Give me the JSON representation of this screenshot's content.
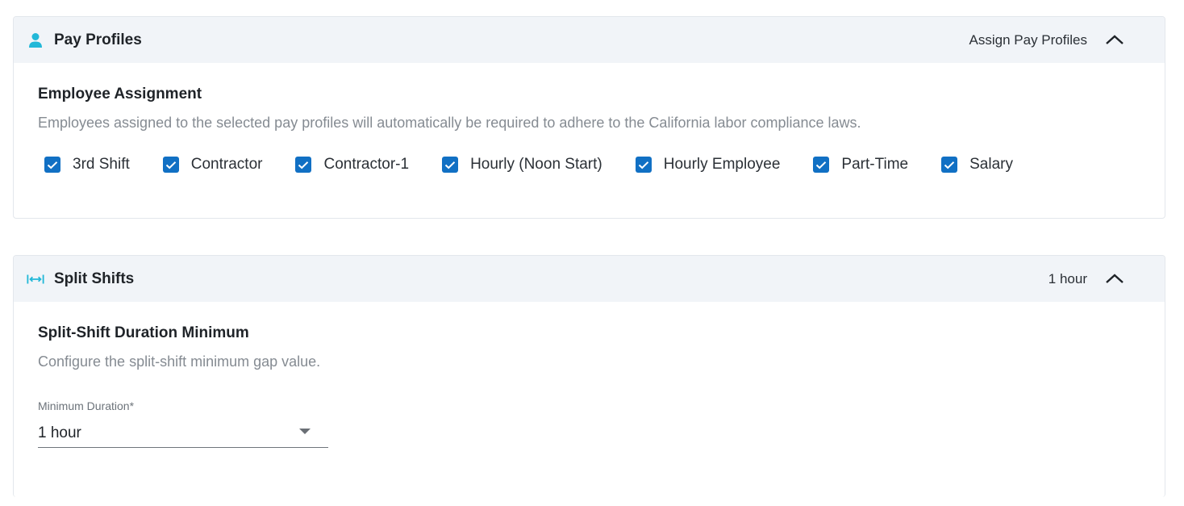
{
  "pay_profiles": {
    "title": "Pay Profiles",
    "summary": "Assign Pay Profiles",
    "icon": "person-icon",
    "section_title": "Employee Assignment",
    "section_desc": "Employees assigned to the selected pay profiles will automatically be required to adhere to the California labor compliance laws.",
    "profiles": [
      {
        "label": "3rd Shift",
        "checked": true
      },
      {
        "label": "Contractor",
        "checked": true
      },
      {
        "label": "Contractor-1",
        "checked": true
      },
      {
        "label": "Hourly (Noon Start)",
        "checked": true
      },
      {
        "label": "Hourly Employee",
        "checked": true
      },
      {
        "label": "Part-Time",
        "checked": true
      },
      {
        "label": "Salary",
        "checked": true
      }
    ]
  },
  "split_shifts": {
    "title": "Split Shifts",
    "summary": "1 hour",
    "icon": "split-arrows-icon",
    "section_title": "Split-Shift Duration Minimum",
    "section_desc": "Configure the split-shift minimum gap value.",
    "field_label": "Minimum Duration*",
    "field_value": "1 hour"
  },
  "colors": {
    "accent": "#1170c4",
    "icon_cyan": "#22b8d8",
    "header_bg": "#f1f4f8"
  }
}
